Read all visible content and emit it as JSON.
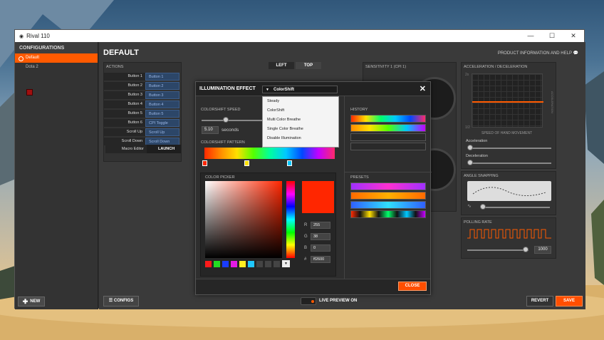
{
  "window": {
    "title": "Rival 110",
    "minimize": "—",
    "maximize": "☐",
    "close": "✕"
  },
  "sidebar": {
    "header": "CONFIGURATIONS",
    "items": [
      {
        "label": "Default",
        "active": true
      },
      {
        "label": "Dota 2",
        "active": false
      }
    ],
    "new_label": "NEW"
  },
  "main": {
    "title": "DEFAULT",
    "product_info": "PRODUCT INFORMATION AND HELP",
    "tabs": [
      "LEFT",
      "TOP"
    ],
    "actions": {
      "header": "ACTIONS",
      "rows": [
        {
          "label": "Button 1",
          "value": "Button 1"
        },
        {
          "label": "Button 2",
          "value": "Button 2"
        },
        {
          "label": "Button 3",
          "value": "Button 3"
        },
        {
          "label": "Button 4",
          "value": "Button 4"
        },
        {
          "label": "Button 5",
          "value": "Button 5"
        },
        {
          "label": "Button 6",
          "value": "CPI Toggle"
        },
        {
          "label": "Scroll Up",
          "value": "Scroll Up"
        },
        {
          "label": "Scroll Down",
          "value": "Scroll Down"
        }
      ],
      "macro_label": "Macro Editor",
      "macro_value": "LAUNCH"
    },
    "sensitivity_header": "SENSITIVITY 1 (CPI 1)",
    "accel": {
      "header": "ACCELERATION / DECELERATION",
      "axis_label": "SPEED OF HAND MOVEMENT",
      "side_label": "ACCELERATION",
      "top_value": "2x",
      "bottom_value": "1/2",
      "accel_label": "Acceleration",
      "decel_label": "Deceleration"
    },
    "angle": {
      "header": "ANGLE SNAPPING"
    },
    "polling": {
      "header": "POLLING RATE",
      "value": "1000"
    },
    "bottom": {
      "configs": "CONFIGS",
      "live_preview": "LIVE PREVIEW ON",
      "revert": "REVERT",
      "save": "SAVE"
    }
  },
  "dialog": {
    "title": "ILLUMINATION EFFECT",
    "selected": "ColorShift",
    "options": [
      "Steady",
      "ColorShift",
      "Multi Color Breathe",
      "Single Color Breathe",
      "Disable Illumination"
    ],
    "speed_label": "COLORSHIFT SPEED",
    "speed_value": "5.10",
    "speed_unit": "seconds",
    "pattern_label": "COLORSHIFT PATTERN",
    "picker_label": "COLOR PICKER",
    "r": "255",
    "g": "38",
    "b": "0",
    "hex": "ff2600",
    "history_label": "HISTORY",
    "presets_label": "PRESETS",
    "close_label": "CLOSE",
    "colors": {
      "accent": "#ff5a00",
      "selected": "#ff2600"
    }
  }
}
